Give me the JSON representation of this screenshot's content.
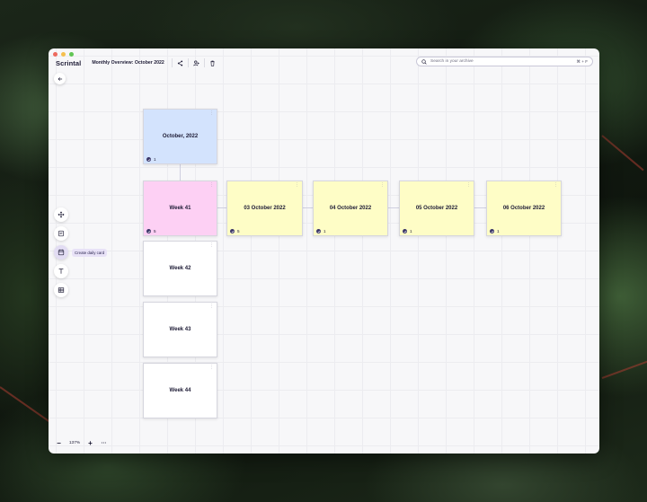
{
  "app": {
    "name": "Scrintal"
  },
  "toolbar": {
    "doc_title": "Monthly Overview: October 2022"
  },
  "search": {
    "placeholder": "Search in your archive",
    "shortcut": "⌘ + F"
  },
  "tools": {
    "items": [
      {
        "icon": "move-icon"
      },
      {
        "icon": "card-icon"
      },
      {
        "icon": "calendar-icon",
        "tooltip": "Create daily card"
      },
      {
        "icon": "text-icon"
      },
      {
        "icon": "table-icon"
      }
    ]
  },
  "zoom": {
    "minus": "−",
    "value": "137%",
    "plus": "+",
    "more": "···"
  },
  "cards": {
    "month": {
      "title": "October, 2022",
      "count": "1"
    },
    "weeks": [
      {
        "title": "Week 41",
        "count": "5"
      },
      {
        "title": "Week 42"
      },
      {
        "title": "Week 43"
      },
      {
        "title": "Week 44"
      }
    ],
    "days": [
      {
        "title": "03 October 2022",
        "count": "5"
      },
      {
        "title": "04 October 2022",
        "count": "1"
      },
      {
        "title": "05 October 2022",
        "count": "1"
      },
      {
        "title": "06 October 2022",
        "count": "1"
      }
    ]
  },
  "colors": {
    "month_card": "#d3e3fd",
    "week_active": "#fdd0f4",
    "day_card": "#fefdc6",
    "accent": "#3b3769"
  }
}
